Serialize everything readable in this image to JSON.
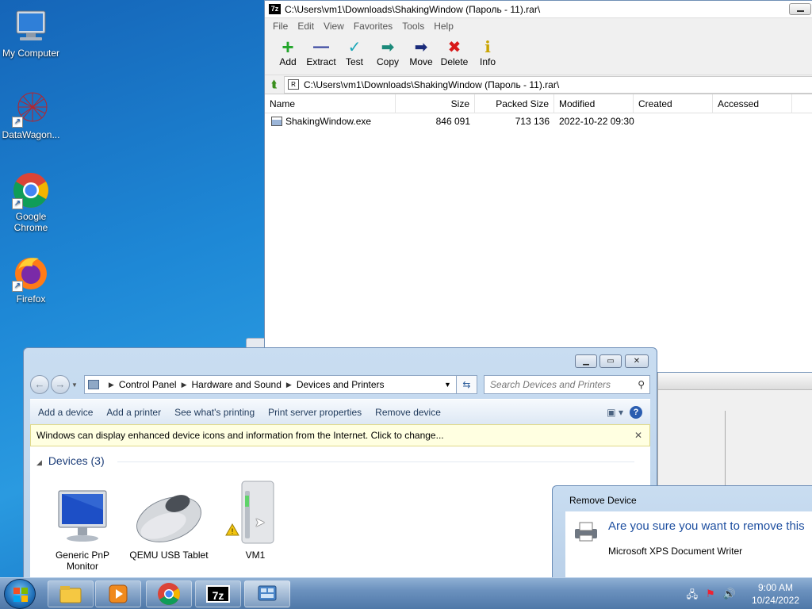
{
  "desktop": {
    "icons": [
      {
        "label": "My Computer"
      },
      {
        "label": "DataWagon..."
      },
      {
        "label": "Google Chrome"
      },
      {
        "label": "Firefox"
      }
    ]
  },
  "zip": {
    "title": "C:\\Users\\vm1\\Downloads\\ShakingWindow (Пароль - 11).rar\\",
    "logo": "7z",
    "menu": [
      "File",
      "Edit",
      "View",
      "Favorites",
      "Tools",
      "Help"
    ],
    "toolbar": [
      {
        "label": "Add",
        "icon": "+",
        "color": "#22a52a"
      },
      {
        "label": "Extract",
        "icon": "—",
        "color": "#2b3a9a"
      },
      {
        "label": "Test",
        "icon": "✓",
        "color": "#1aa6b8"
      },
      {
        "label": "Copy",
        "icon": "➡",
        "color": "#1b8a7a"
      },
      {
        "label": "Move",
        "icon": "➡",
        "color": "#1a2b7a"
      },
      {
        "label": "Delete",
        "icon": "✖",
        "color": "#d81818"
      },
      {
        "label": "Info",
        "icon": "i",
        "color": "#c9a400"
      }
    ],
    "path": "C:\\Users\\vm1\\Downloads\\ShakingWindow (Пароль - 11).rar\\",
    "columns": [
      "Name",
      "Size",
      "Packed Size",
      "Modified",
      "Created",
      "Accessed"
    ],
    "files": [
      {
        "name": "ShakingWindow.exe",
        "size": "846 091",
        "packed": "713 136",
        "modified": "2022-10-22 09:30",
        "created": "",
        "accessed": ""
      }
    ]
  },
  "cp": {
    "breadcrumb": [
      "Control Panel",
      "Hardware and Sound",
      "Devices and Printers"
    ],
    "search_placeholder": "Search Devices and Printers",
    "commands": [
      "Add a device",
      "Add a printer",
      "See what's printing",
      "Print server properties",
      "Remove device"
    ],
    "infobar": "Windows can display enhanced device icons and information from the Internet. Click to change...",
    "group": "Devices (3)",
    "devices": [
      {
        "label": "Generic PnP Monitor"
      },
      {
        "label": "QEMU USB Tablet"
      },
      {
        "label": "VM1"
      }
    ]
  },
  "dialog": {
    "title": "Remove Device",
    "question": "Are you sure you want to remove this",
    "device": "Microsoft XPS Document Writer"
  },
  "taskbar": {
    "time": "9:00 AM",
    "date": "10/24/2022",
    "apps": [
      "explorer",
      "media-player",
      "chrome",
      "7-zip",
      "control-panel"
    ]
  }
}
